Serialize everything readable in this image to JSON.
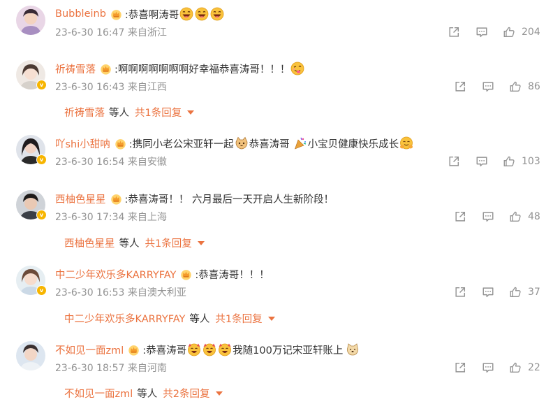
{
  "comments": [
    {
      "username": "Bubbleinb",
      "text": ":恭喜啊涛哥",
      "time": "23-6-30 16:47",
      "location": "来自浙江",
      "likes": "204",
      "emojis": [
        "laugh-emoji",
        "laugh-emoji",
        "laugh-emoji"
      ],
      "verified": false
    },
    {
      "username": "祈祷雪落",
      "text": ":啊啊啊啊啊啊啊好幸福恭喜涛哥！！！",
      "time": "23-6-30 16:43",
      "location": "来自江西",
      "likes": "86",
      "emojis": [
        "tongue-wink-emoji"
      ],
      "verified": true,
      "reply_summary": {
        "name": "祈祷雪落",
        "mid": "等人",
        "more": "共1条回复"
      }
    },
    {
      "username": "吖shi小甜呐",
      "text": ":携同小老公宋亚轩一起",
      "text2": "恭喜涛哥",
      "text3": "小宝贝健康快乐成长",
      "time": "23-6-30 16:54",
      "location": "来自安徽",
      "likes": "103",
      "verified": true
    },
    {
      "username": "西柚色星星",
      "text": ":恭喜涛哥！！ 六月最后一天开启人生新阶段！",
      "time": "23-6-30 17:34",
      "location": "来自上海",
      "likes": "48",
      "verified": true,
      "reply_summary": {
        "name": "西柚色星星",
        "mid": "等人",
        "more": "共1条回复"
      }
    },
    {
      "username": "中二少年欢乐多KARRYFAY",
      "text": ":恭喜涛哥！！！",
      "time": "23-6-30 16:53",
      "location": "来自澳大利亚",
      "likes": "37",
      "verified": true,
      "reply_summary": {
        "name": "中二少年欢乐多KARRYFAY",
        "mid": "等人",
        "more": "共1条回复"
      }
    },
    {
      "username": "不如见一面zml",
      "text": ":恭喜涛哥",
      "text2": "我随100万记宋亚轩账上",
      "time": "23-6-30 18:57",
      "location": "来自河南",
      "likes": "22",
      "verified": false,
      "reply_summary": {
        "name": "不如见一面zml",
        "mid": "等人",
        "more": "共2条回复"
      }
    }
  ],
  "colors": {
    "accent": "#eb7340",
    "meta": "#939393",
    "text": "#333333",
    "badge": "#f7b500"
  },
  "icons": {
    "share": "share-icon",
    "comment": "comment-icon",
    "like": "thumbs-up-icon",
    "crown": "crown-badge-icon",
    "verified": "verified-badge-icon"
  }
}
